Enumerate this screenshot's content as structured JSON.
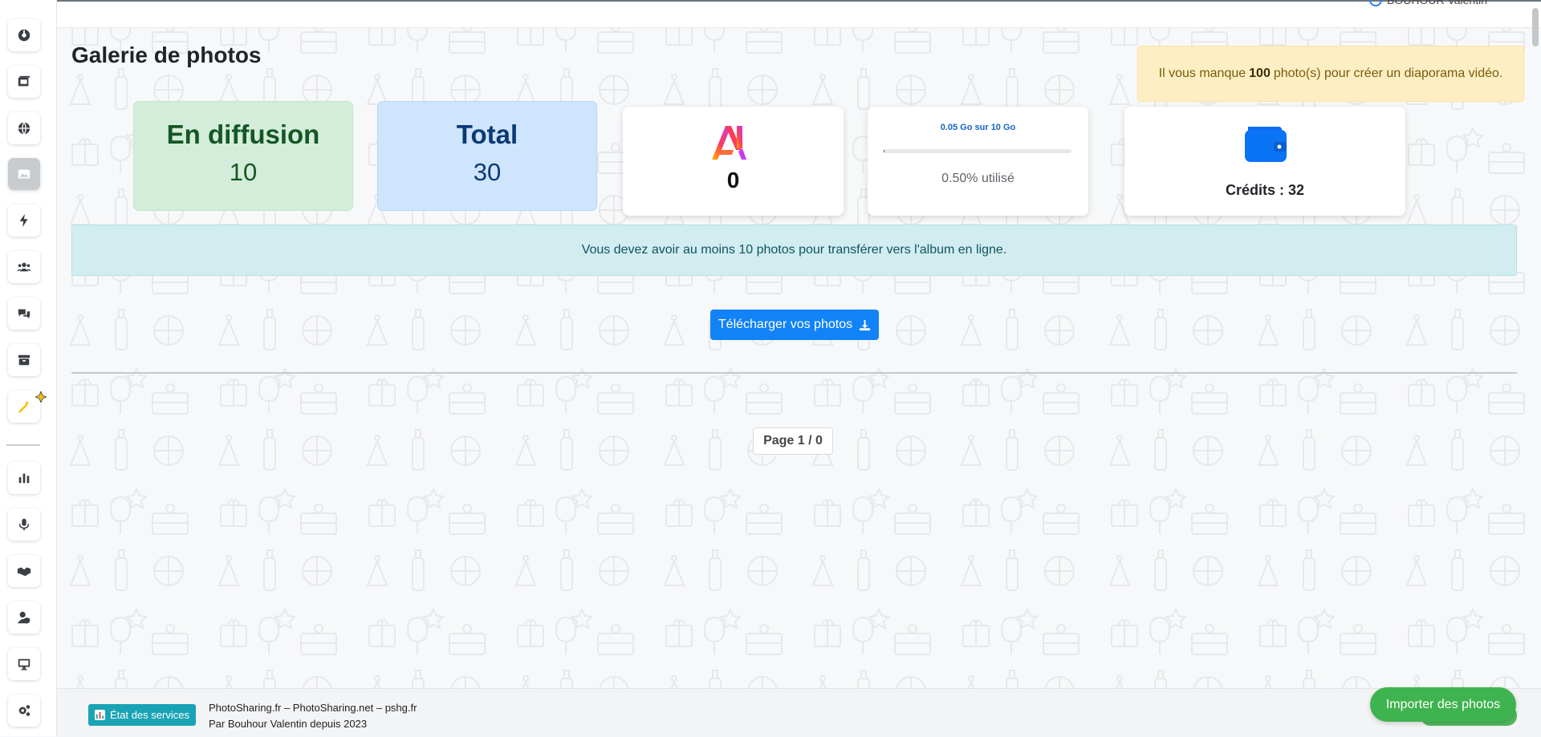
{
  "header": {
    "user_name": "BOUHOUR Valentin"
  },
  "page": {
    "title": "Galerie de photos"
  },
  "alert_warning": {
    "prefix": "Il vous manque",
    "count": "100",
    "suffix": "photo(s) pour créer un diaporama vidéo."
  },
  "stats": {
    "broadcasting": {
      "label": "En diffusion",
      "value": "10"
    },
    "total": {
      "label": "Total",
      "value": "30"
    }
  },
  "ai_card": {
    "value": "0",
    "icon": "ai-logo-icon"
  },
  "storage_card": {
    "label": "0.05 Go sur 10 Go",
    "used_text": "0.50% utilisé",
    "used_fraction": 0.005
  },
  "credits_card": {
    "text": "Crédits : 32",
    "icon": "wallet-icon"
  },
  "alert_info": {
    "text": "Vous devez avoir au moins 10 photos pour transférer vers l'album en ligne."
  },
  "download": {
    "label": "Télécharger vos photos"
  },
  "pagination": {
    "label": "Page 1 / 0"
  },
  "footer": {
    "status_label": "État des services",
    "line1": "PhotoSharing.fr – PhotoSharing.net – pshg.fr",
    "line2": "Par Bouhour Valentin depuis 2023"
  },
  "import": {
    "label": "Importer des photos"
  },
  "sidebar": {
    "items": [
      {
        "icon": "dashboard-icon"
      },
      {
        "icon": "photos-icon"
      },
      {
        "icon": "globe-icon"
      },
      {
        "icon": "image-icon",
        "active": true
      },
      {
        "icon": "bolt-icon"
      },
      {
        "icon": "users-icon"
      },
      {
        "icon": "comments-icon"
      },
      {
        "icon": "archive-icon"
      },
      {
        "icon": "magic-wand-icon"
      },
      {
        "icon": "chart-icon"
      },
      {
        "icon": "microphone-icon"
      },
      {
        "icon": "handshake-icon"
      },
      {
        "icon": "user-shield-icon"
      },
      {
        "icon": "desktop-icon"
      },
      {
        "icon": "settings-icon"
      }
    ]
  },
  "colors": {
    "primary": "#1283f6",
    "success_bg": "#d4edda",
    "info_bg": "#d2edf0",
    "warning_bg": "#fdefc3",
    "import_green": "#3fb34f"
  }
}
